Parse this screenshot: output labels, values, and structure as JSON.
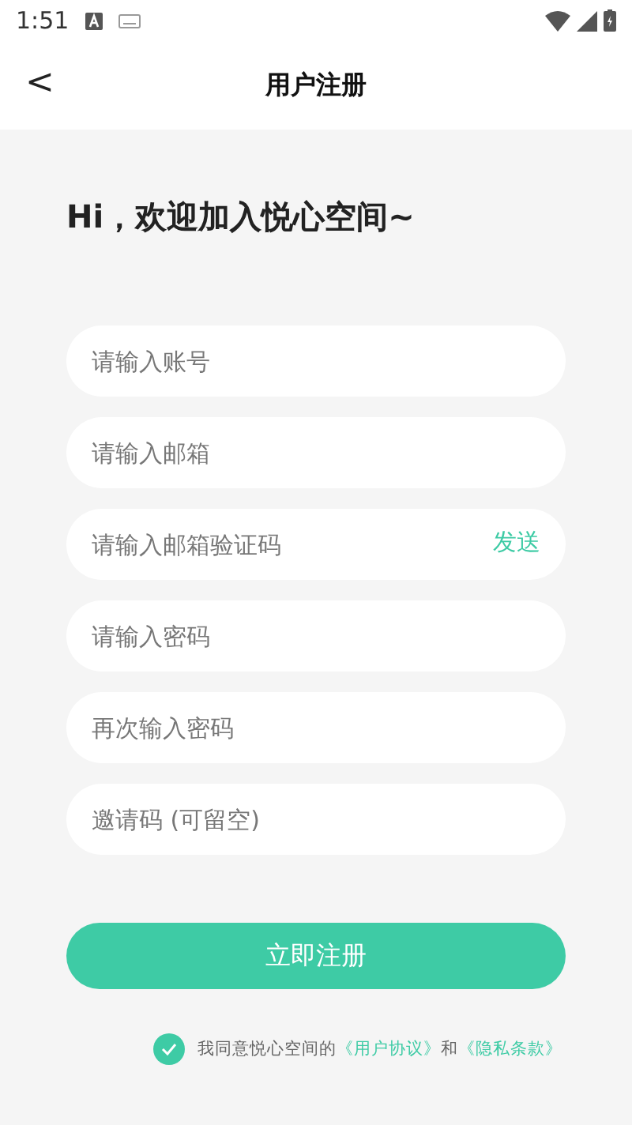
{
  "status_bar": {
    "time": "1:51"
  },
  "header": {
    "back": "<",
    "title": "用户注册"
  },
  "greeting": "Hi，欢迎加入悦心空间~",
  "fields": [
    {
      "placeholder": "请输入账号"
    },
    {
      "placeholder": "请输入邮箱"
    },
    {
      "placeholder": "请输入邮箱验证码",
      "action": "发送"
    },
    {
      "placeholder": "请输入密码"
    },
    {
      "placeholder": "再次输入密码"
    },
    {
      "placeholder": "邀请码 (可留空)"
    }
  ],
  "submit": "立即注册",
  "agreement": {
    "checked": true,
    "text": "我同意悦心空间的",
    "link1": "《用户协议》",
    "joiner": "和",
    "link2": "《隐私条款》"
  }
}
